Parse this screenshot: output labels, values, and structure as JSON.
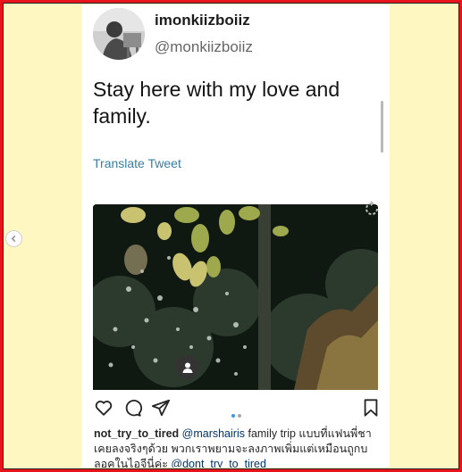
{
  "tweet": {
    "display_name": "imonkiizboiiz",
    "handle": "@monkiizboiiz",
    "text": "Stay here with my love and family.",
    "translate_label": "Translate Tweet"
  },
  "instagram": {
    "caption_username": "not_try_to_tired",
    "caption_mention_1": "@marshairis",
    "caption_text": "family trip แบบที่แฟนพี่ชาเคยลงจริงๆด้วย พวกเราพยามจะลงภาพเพิ่มแต่เหมือนถูกบลอคในไอจีนี่ค่ะ",
    "caption_mention_2": "@dont_try_to_tired",
    "carousel_dots": 2,
    "active_dot": 1
  },
  "icons": [
    "chevron-left-icon",
    "heart-icon",
    "comment-icon",
    "share-icon",
    "bookmark-icon",
    "user-tag-icon",
    "refresh-icon"
  ],
  "colors": {
    "frame_border": "#e8141b",
    "frame_bg": "#fff7c2",
    "link": "#3b7ea1",
    "mention": "#00376b",
    "active_dot": "#3897f0"
  }
}
